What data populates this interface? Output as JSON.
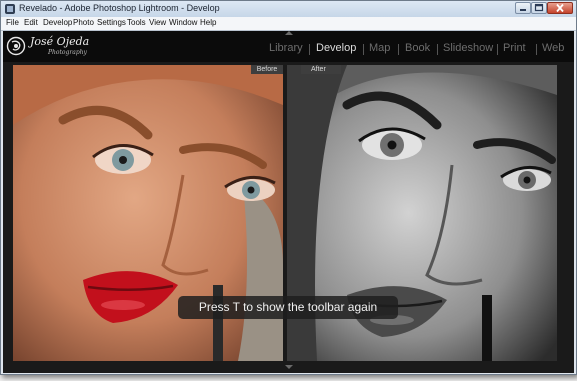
{
  "window": {
    "title": "Revelado - Adobe Photoshop Lightroom - Develop",
    "controls": {
      "minimize": "minimize",
      "maximize": "maximize",
      "close": "close"
    }
  },
  "menu": {
    "items": [
      "File",
      "Edit",
      "Develop",
      "Photo",
      "Settings",
      "Tools",
      "View",
      "Window",
      "Help"
    ]
  },
  "identity_plate": {
    "name": "José Ojeda",
    "subtitle": "Photography"
  },
  "modules": {
    "items": [
      "Library",
      "Develop",
      "Map",
      "Book",
      "Slideshow",
      "Print",
      "Web"
    ],
    "active": "Develop"
  },
  "view": {
    "before_label": "Before",
    "after_label": "After",
    "toast": "Press T to show the toolbar again"
  },
  "colors": {
    "background": "#111111",
    "module_inactive": "#6d6d6d",
    "module_active": "#dcdcdc",
    "lips": "#c2101c"
  }
}
